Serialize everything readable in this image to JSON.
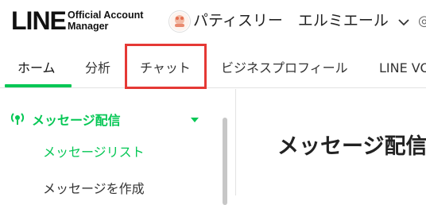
{
  "header": {
    "logo_main": "LINE",
    "logo_sub_line1": "Official Account",
    "logo_sub_line2": "Manager",
    "account_name": "パティスリー　エルミエール"
  },
  "tabs": [
    {
      "label": "ホーム",
      "active": true
    },
    {
      "label": "分析",
      "active": false
    },
    {
      "label": "チャット",
      "active": false,
      "highlighted": true
    },
    {
      "label": "ビジネスプロフィール",
      "active": false
    },
    {
      "label": "LINE VO",
      "active": false
    }
  ],
  "sidebar": {
    "section_label": "メッセージ配信",
    "items": [
      {
        "label": "メッセージリスト",
        "active": true
      },
      {
        "label": "メッセージを作成",
        "active": false
      }
    ]
  },
  "main": {
    "title": "メッセージ配信"
  },
  "colors": {
    "brand_green": "#06c755",
    "highlight_red": "#e53935"
  },
  "icons": {
    "chevron": "chevron-down-icon",
    "broadcast": "broadcast-icon",
    "avatar": "account-avatar"
  }
}
